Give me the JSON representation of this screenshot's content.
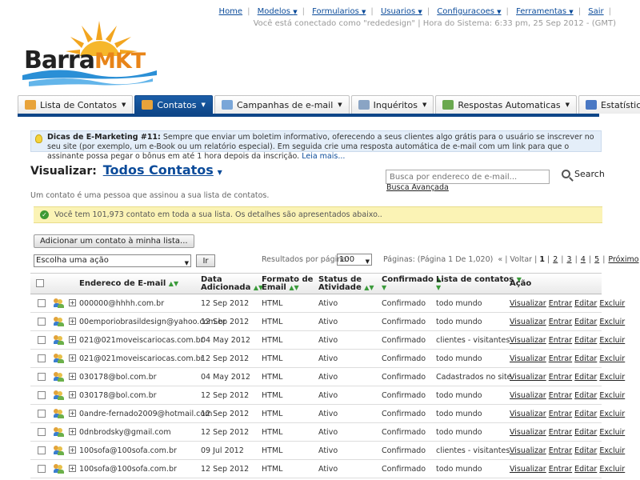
{
  "brand": {
    "part1": "Barra",
    "part2": "MKT"
  },
  "topnav": {
    "home": "Home",
    "modelos": "Modelos",
    "formularios": "Formularios",
    "usuarios": "Usuarios",
    "configuracoes": "Configuracoes",
    "ferramentas": "Ferramentas",
    "sair": "Sair",
    "userline": "Você está conectado como \"rededesign\" | Hora do Sistema: 6:33 pm, 25 Sep 2012 - (GMT)"
  },
  "tabs": [
    {
      "label": "Lista de Contatos",
      "icon": "list-icon",
      "color": "#e8a33a"
    },
    {
      "label": "Contatos",
      "icon": "contacts-icon",
      "color": "#e8a33a"
    },
    {
      "label": "Campanhas de e-mail",
      "icon": "envelope-icon",
      "color": "#7aa6d8"
    },
    {
      "label": "Inquéritos",
      "icon": "survey-icon",
      "color": "#8aa4c4"
    },
    {
      "label": "Respostas Automaticas",
      "icon": "autoresponder-icon",
      "color": "#6aa84f"
    },
    {
      "label": "Estatísticas",
      "icon": "chart-icon",
      "color": "#4a78c4"
    }
  ],
  "tip": {
    "title": "Dicas de E-Marketing #11:",
    "text": " Sempre que enviar um boletim informativo, oferecendo a seus clientes algo grátis para o usuário se inscrever no seu site (por exemplo, um e-Book ou um relatório especial). Em seguida crie uma resposta automática de e-mail com um link para que o assinante possa pegar o bônus em até 1 hora depois da inscrição. ",
    "more": "Leia mais..."
  },
  "view": {
    "label": "Visualizar:",
    "value": "Todos Contatos"
  },
  "search": {
    "placeholder": "Busca por endereco de e-mail...",
    "button": "Search",
    "advanced": "Busca Avançada"
  },
  "description": "Um contato é uma pessoa que assinou a sua lista de contatos.",
  "notice": "Você tem 101,973 contato em toda a sua lista. Os detalhes são apresentados abaixo..",
  "add_button": "Adicionar um contato à minha lista...",
  "action_select": "Escolha uma ação",
  "go_button": "Ir",
  "perpage": {
    "label": "Resultados por página:",
    "value": "100"
  },
  "pager": {
    "info": "Páginas: (Página 1 De 1,020)",
    "prev": "« | Voltar |",
    "current": "1",
    "pages": [
      "2",
      "3",
      "4",
      "5"
    ],
    "next": "Próximo",
    "last": "»"
  },
  "columns": {
    "email": "Endereco de E-mail",
    "date1": "Data",
    "date2": "Adicionada",
    "format1": "Formato de",
    "format2": "Email",
    "status1": "Status de",
    "status2": "Atividade",
    "confirmed": "Confirmado",
    "list": "Lista de contatos",
    "action": "Ação"
  },
  "row_actions": {
    "view": "Visualizar",
    "enter": "Entrar",
    "edit": "Editar",
    "delete": "Excluir"
  },
  "rows": [
    {
      "email": "000000@hhhh.com.br",
      "date": "12 Sep 2012",
      "format": "HTML",
      "status": "Ativo",
      "confirmed": "Confirmado",
      "list": "todo mundo"
    },
    {
      "email": "00emporiobrasildesign@yahoo.com.br",
      "date": "12 Sep 2012",
      "format": "HTML",
      "status": "Ativo",
      "confirmed": "Confirmado",
      "list": "todo mundo"
    },
    {
      "email": "021@021moveiscariocas.com.br",
      "date": "04 May 2012",
      "format": "HTML",
      "status": "Ativo",
      "confirmed": "Confirmado",
      "list": "clientes - visitantes"
    },
    {
      "email": "021@021moveiscariocas.com.br",
      "date": "12 Sep 2012",
      "format": "HTML",
      "status": "Ativo",
      "confirmed": "Confirmado",
      "list": "todo mundo"
    },
    {
      "email": "030178@bol.com.br",
      "date": "04 May 2012",
      "format": "HTML",
      "status": "Ativo",
      "confirmed": "Confirmado",
      "list": "Cadastrados no site"
    },
    {
      "email": "030178@bol.com.br",
      "date": "12 Sep 2012",
      "format": "HTML",
      "status": "Ativo",
      "confirmed": "Confirmado",
      "list": "todo mundo"
    },
    {
      "email": "0andre-fernado2009@hotmail.com",
      "date": "12 Sep 2012",
      "format": "HTML",
      "status": "Ativo",
      "confirmed": "Confirmado",
      "list": "todo mundo"
    },
    {
      "email": "0dnbrodsky@gmail.com",
      "date": "12 Sep 2012",
      "format": "HTML",
      "status": "Ativo",
      "confirmed": "Confirmado",
      "list": "todo mundo"
    },
    {
      "email": "100sofa@100sofa.com.br",
      "date": "09 Jul 2012",
      "format": "HTML",
      "status": "Ativo",
      "confirmed": "Confirmado",
      "list": "clientes - visitantes"
    },
    {
      "email": "100sofa@100sofa.com.br",
      "date": "12 Sep 2012",
      "format": "HTML",
      "status": "Ativo",
      "confirmed": "Confirmado",
      "list": "todo mundo"
    }
  ]
}
